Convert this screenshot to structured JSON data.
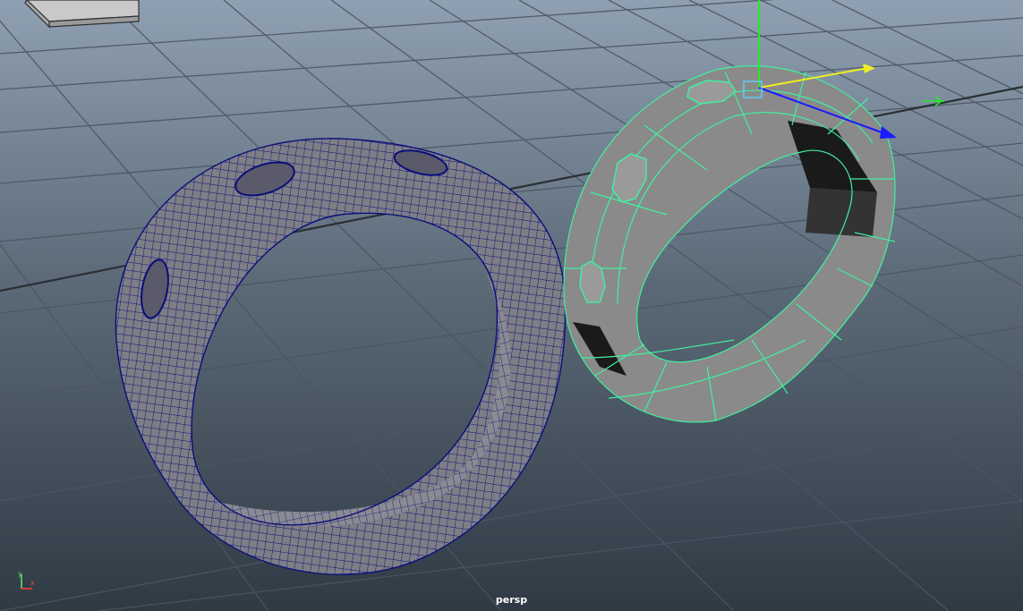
{
  "viewport": {
    "camera_name": "persp",
    "background_top": "#8fa0b2",
    "background_bottom": "#2f3a44",
    "grid_color": "#4a5662",
    "axis_line_color": "#2a2f34"
  },
  "objects": {
    "smoothed_ring": {
      "wire_color": "#0b0f7a",
      "fill": "#7e7e86"
    },
    "selected_ring": {
      "wire_color": "#40f0a0",
      "fill": "#8a8a8a",
      "dark_face": "#1a1a1a"
    }
  },
  "manipulator": {
    "y_color": "#22ee22",
    "x_color": "#eeee22",
    "z_color": "#1a1aff",
    "center_color": "#5fd0ff"
  },
  "axis_indicator": {
    "x_label": "x",
    "y_label": "y",
    "x_color": "#ff3b3b",
    "y_color": "#59e35a"
  }
}
